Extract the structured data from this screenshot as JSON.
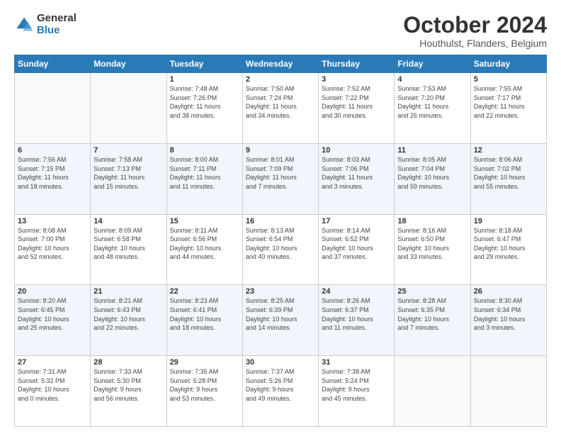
{
  "header": {
    "logo_general": "General",
    "logo_blue": "Blue",
    "month_title": "October 2024",
    "location": "Houthulst, Flanders, Belgium"
  },
  "weekdays": [
    "Sunday",
    "Monday",
    "Tuesday",
    "Wednesday",
    "Thursday",
    "Friday",
    "Saturday"
  ],
  "weeks": [
    [
      {
        "day": "",
        "info": ""
      },
      {
        "day": "",
        "info": ""
      },
      {
        "day": "1",
        "info": "Sunrise: 7:48 AM\nSunset: 7:26 PM\nDaylight: 11 hours\nand 38 minutes."
      },
      {
        "day": "2",
        "info": "Sunrise: 7:50 AM\nSunset: 7:24 PM\nDaylight: 11 hours\nand 34 minutes."
      },
      {
        "day": "3",
        "info": "Sunrise: 7:52 AM\nSunset: 7:22 PM\nDaylight: 11 hours\nand 30 minutes."
      },
      {
        "day": "4",
        "info": "Sunrise: 7:53 AM\nSunset: 7:20 PM\nDaylight: 11 hours\nand 26 minutes."
      },
      {
        "day": "5",
        "info": "Sunrise: 7:55 AM\nSunset: 7:17 PM\nDaylight: 11 hours\nand 22 minutes."
      }
    ],
    [
      {
        "day": "6",
        "info": "Sunrise: 7:56 AM\nSunset: 7:15 PM\nDaylight: 11 hours\nand 18 minutes."
      },
      {
        "day": "7",
        "info": "Sunrise: 7:58 AM\nSunset: 7:13 PM\nDaylight: 11 hours\nand 15 minutes."
      },
      {
        "day": "8",
        "info": "Sunrise: 8:00 AM\nSunset: 7:11 PM\nDaylight: 11 hours\nand 11 minutes."
      },
      {
        "day": "9",
        "info": "Sunrise: 8:01 AM\nSunset: 7:09 PM\nDaylight: 11 hours\nand 7 minutes."
      },
      {
        "day": "10",
        "info": "Sunrise: 8:03 AM\nSunset: 7:06 PM\nDaylight: 11 hours\nand 3 minutes."
      },
      {
        "day": "11",
        "info": "Sunrise: 8:05 AM\nSunset: 7:04 PM\nDaylight: 10 hours\nand 59 minutes."
      },
      {
        "day": "12",
        "info": "Sunrise: 8:06 AM\nSunset: 7:02 PM\nDaylight: 10 hours\nand 55 minutes."
      }
    ],
    [
      {
        "day": "13",
        "info": "Sunrise: 8:08 AM\nSunset: 7:00 PM\nDaylight: 10 hours\nand 52 minutes."
      },
      {
        "day": "14",
        "info": "Sunrise: 8:09 AM\nSunset: 6:58 PM\nDaylight: 10 hours\nand 48 minutes."
      },
      {
        "day": "15",
        "info": "Sunrise: 8:11 AM\nSunset: 6:56 PM\nDaylight: 10 hours\nand 44 minutes."
      },
      {
        "day": "16",
        "info": "Sunrise: 8:13 AM\nSunset: 6:54 PM\nDaylight: 10 hours\nand 40 minutes."
      },
      {
        "day": "17",
        "info": "Sunrise: 8:14 AM\nSunset: 6:52 PM\nDaylight: 10 hours\nand 37 minutes."
      },
      {
        "day": "18",
        "info": "Sunrise: 8:16 AM\nSunset: 6:50 PM\nDaylight: 10 hours\nand 33 minutes."
      },
      {
        "day": "19",
        "info": "Sunrise: 8:18 AM\nSunset: 6:47 PM\nDaylight: 10 hours\nand 29 minutes."
      }
    ],
    [
      {
        "day": "20",
        "info": "Sunrise: 8:20 AM\nSunset: 6:45 PM\nDaylight: 10 hours\nand 25 minutes."
      },
      {
        "day": "21",
        "info": "Sunrise: 8:21 AM\nSunset: 6:43 PM\nDaylight: 10 hours\nand 22 minutes."
      },
      {
        "day": "22",
        "info": "Sunrise: 8:23 AM\nSunset: 6:41 PM\nDaylight: 10 hours\nand 18 minutes."
      },
      {
        "day": "23",
        "info": "Sunrise: 8:25 AM\nSunset: 6:39 PM\nDaylight: 10 hours\nand 14 minutes."
      },
      {
        "day": "24",
        "info": "Sunrise: 8:26 AM\nSunset: 6:37 PM\nDaylight: 10 hours\nand 11 minutes."
      },
      {
        "day": "25",
        "info": "Sunrise: 8:28 AM\nSunset: 6:35 PM\nDaylight: 10 hours\nand 7 minutes."
      },
      {
        "day": "26",
        "info": "Sunrise: 8:30 AM\nSunset: 6:34 PM\nDaylight: 10 hours\nand 3 minutes."
      }
    ],
    [
      {
        "day": "27",
        "info": "Sunrise: 7:31 AM\nSunset: 5:32 PM\nDaylight: 10 hours\nand 0 minutes."
      },
      {
        "day": "28",
        "info": "Sunrise: 7:33 AM\nSunset: 5:30 PM\nDaylight: 9 hours\nand 56 minutes."
      },
      {
        "day": "29",
        "info": "Sunrise: 7:35 AM\nSunset: 5:28 PM\nDaylight: 9 hours\nand 53 minutes."
      },
      {
        "day": "30",
        "info": "Sunrise: 7:37 AM\nSunset: 5:26 PM\nDaylight: 9 hours\nand 49 minutes."
      },
      {
        "day": "31",
        "info": "Sunrise: 7:38 AM\nSunset: 5:24 PM\nDaylight: 9 hours\nand 45 minutes."
      },
      {
        "day": "",
        "info": ""
      },
      {
        "day": "",
        "info": ""
      }
    ]
  ]
}
